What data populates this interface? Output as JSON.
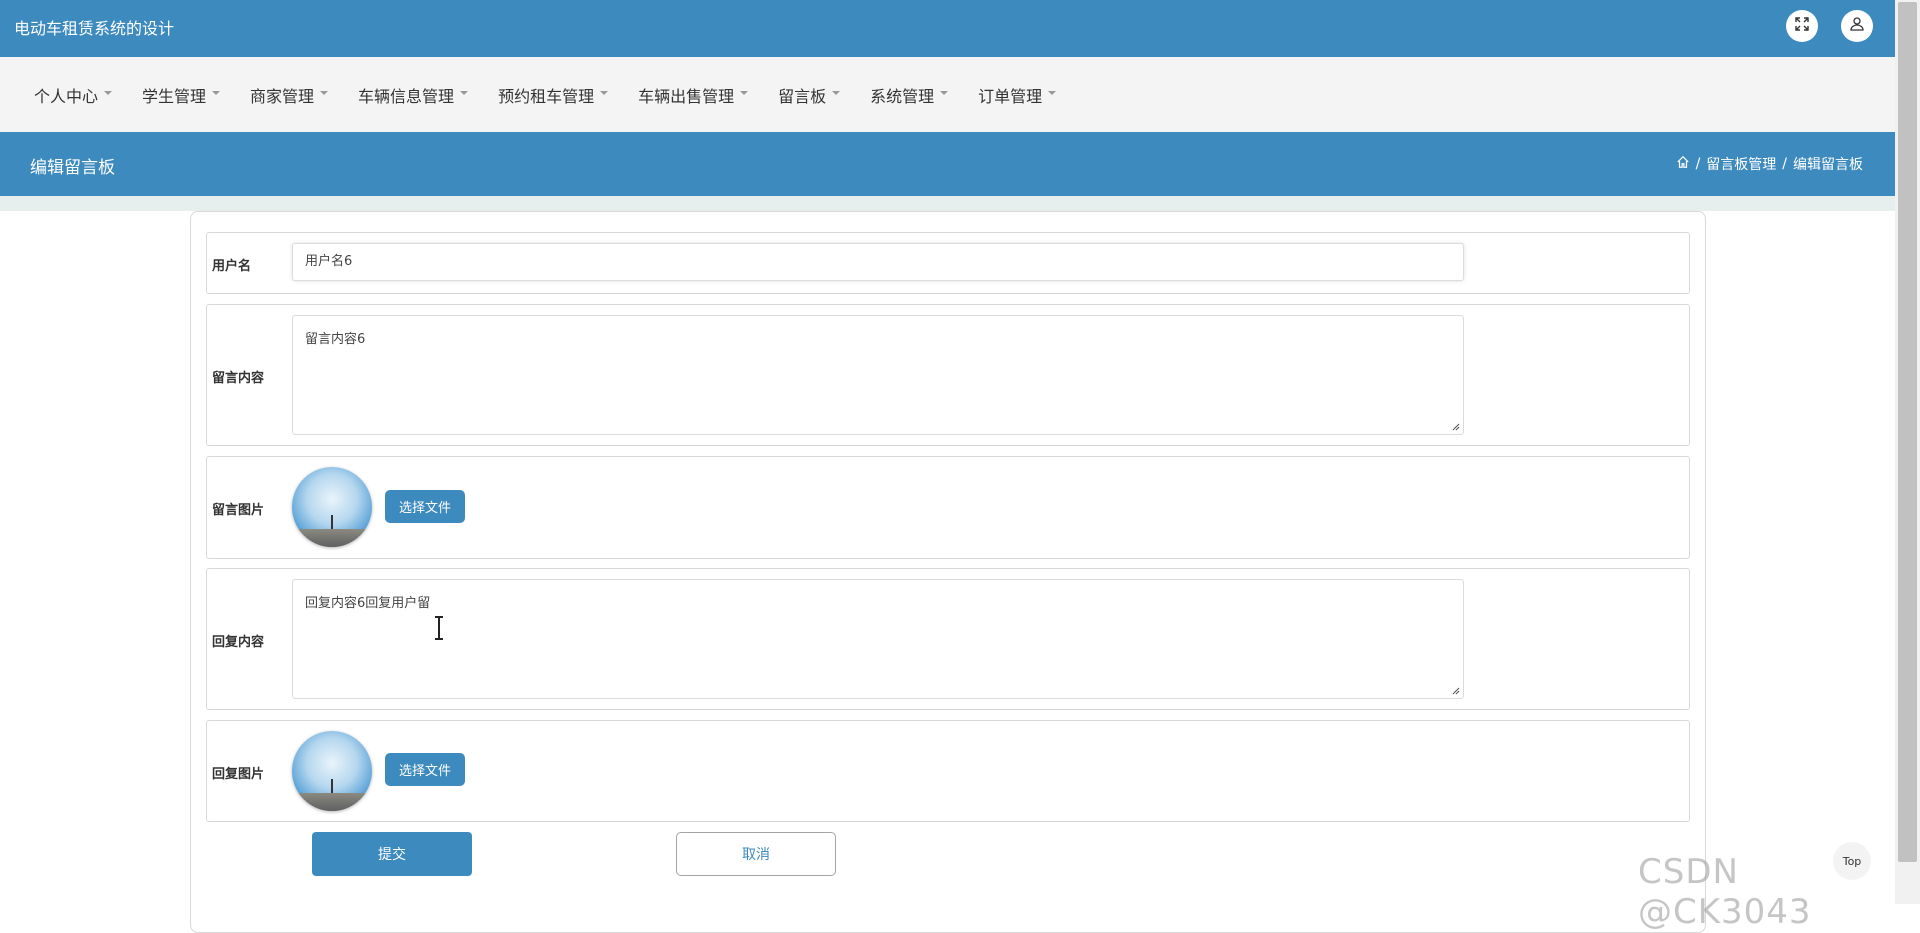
{
  "app": {
    "title": "电动车租赁系统的设计"
  },
  "nav": {
    "items": [
      {
        "label": "个人中心"
      },
      {
        "label": "学生管理"
      },
      {
        "label": "商家管理"
      },
      {
        "label": "车辆信息管理"
      },
      {
        "label": "预约租车管理"
      },
      {
        "label": "车辆出售管理"
      },
      {
        "label": "留言板"
      },
      {
        "label": "系统管理"
      },
      {
        "label": "订单管理"
      }
    ]
  },
  "page": {
    "title": "编辑留言板",
    "breadcrumb": [
      "留言板管理",
      "编辑留言板"
    ]
  },
  "form": {
    "username": {
      "label": "用户名",
      "value": "用户名6"
    },
    "message": {
      "label": "留言内容",
      "value": "留言内容6"
    },
    "message_image": {
      "label": "留言图片",
      "button": "选择文件"
    },
    "reply": {
      "label": "回复内容",
      "value": "回复内容6回复用户留"
    },
    "reply_image": {
      "label": "回复图片",
      "button": "选择文件"
    },
    "submit": "提交",
    "cancel": "取消"
  },
  "top_button": "Top",
  "watermark": "CSDN @CK3043",
  "colors": {
    "primary": "#3d8abf",
    "nav_bg": "#f4f4f4"
  },
  "icons": {
    "fullscreen": "fullscreen-icon",
    "user": "user-icon",
    "home": "home-icon"
  }
}
